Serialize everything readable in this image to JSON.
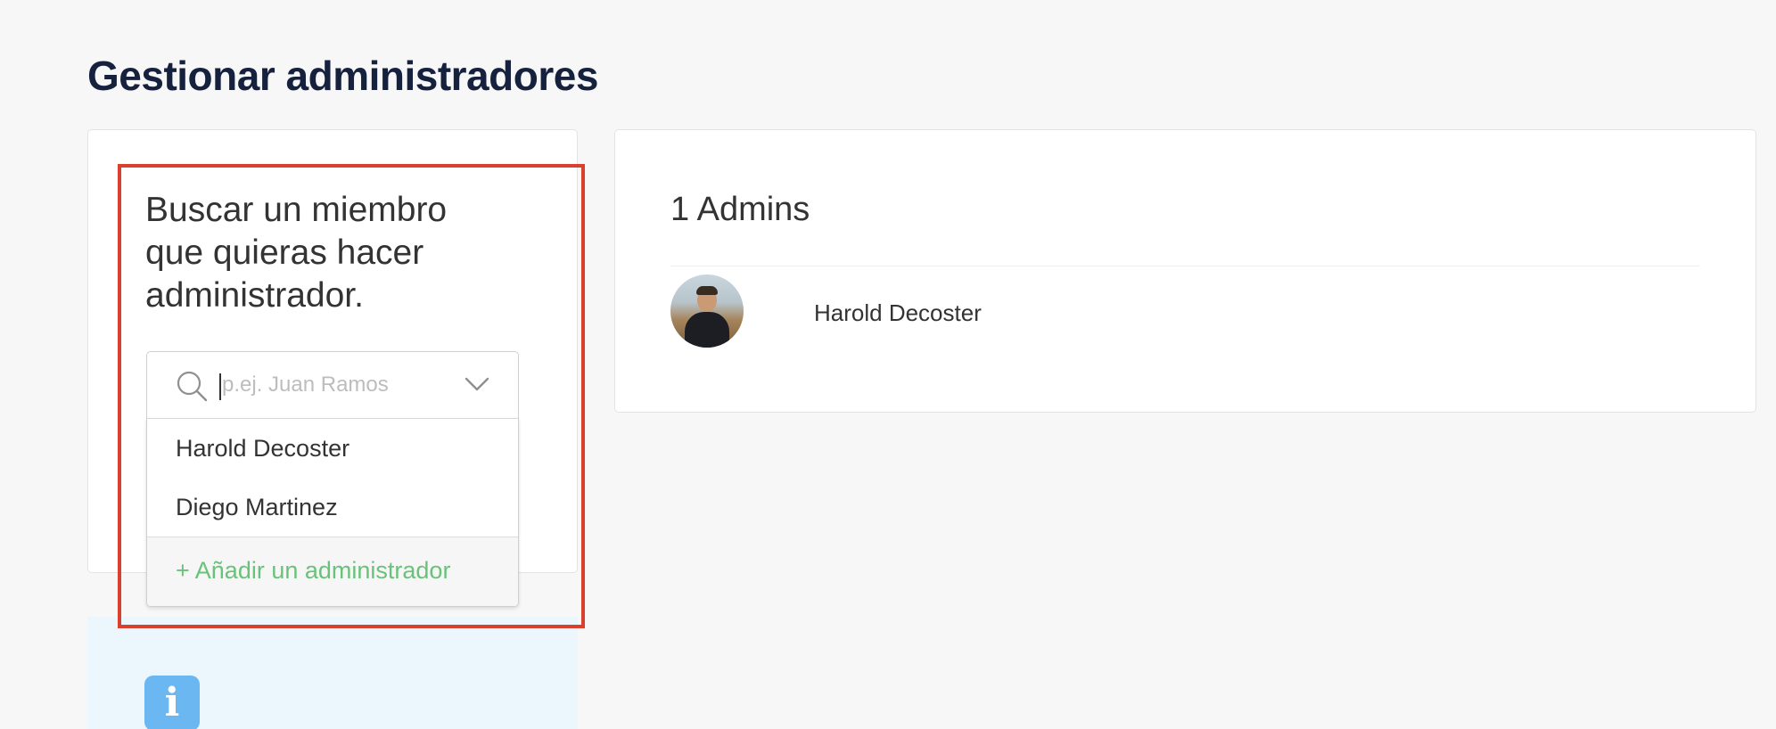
{
  "page": {
    "title": "Gestionar administradores"
  },
  "search_panel": {
    "heading": "Buscar un miembro que quieras hacer administrador.",
    "search": {
      "placeholder": "p.ej. Juan Ramos",
      "value": "",
      "icon": "search-icon",
      "toggle_icon": "chevron-down-icon"
    },
    "dropdown": {
      "options": [
        "Harold Decoster",
        "Diego Martinez"
      ],
      "add_label": "+ Añadir un administrador"
    }
  },
  "admins_panel": {
    "title": "1 Admins",
    "admins": [
      {
        "name": "Harold Decoster",
        "avatar": "avatar-photo"
      }
    ]
  },
  "info_box": {
    "icon": "info-icon"
  },
  "colors": {
    "title": "#16213e",
    "highlight": "#d9402e",
    "add_link": "#6ac27a",
    "info_bg": "#ecf6fd",
    "info_icon": "#6ab7f2"
  }
}
